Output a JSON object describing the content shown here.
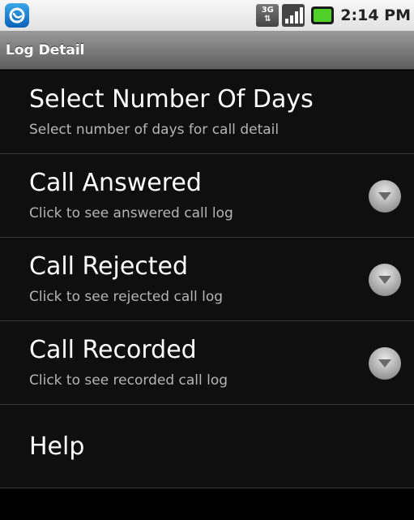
{
  "status_bar": {
    "network_label": "3G",
    "time": "2:14 PM"
  },
  "title_bar": {
    "title": "Log Detail"
  },
  "items": [
    {
      "title": "Select Number Of Days",
      "subtitle": "Select number of days for call detail"
    },
    {
      "title": "Call Answered",
      "subtitle": "Click to see answered call log"
    },
    {
      "title": "Call Rejected",
      "subtitle": "Click to see rejected call log"
    },
    {
      "title": "Call Recorded",
      "subtitle": "Click to see recorded call log"
    },
    {
      "title": "Help"
    }
  ],
  "icons": {
    "notification": "app-notification-icon",
    "network": "3g-network-icon",
    "signal": "signal-strength-icon",
    "battery": "battery-charging-icon",
    "expand": "chevron-down-circle-icon"
  }
}
